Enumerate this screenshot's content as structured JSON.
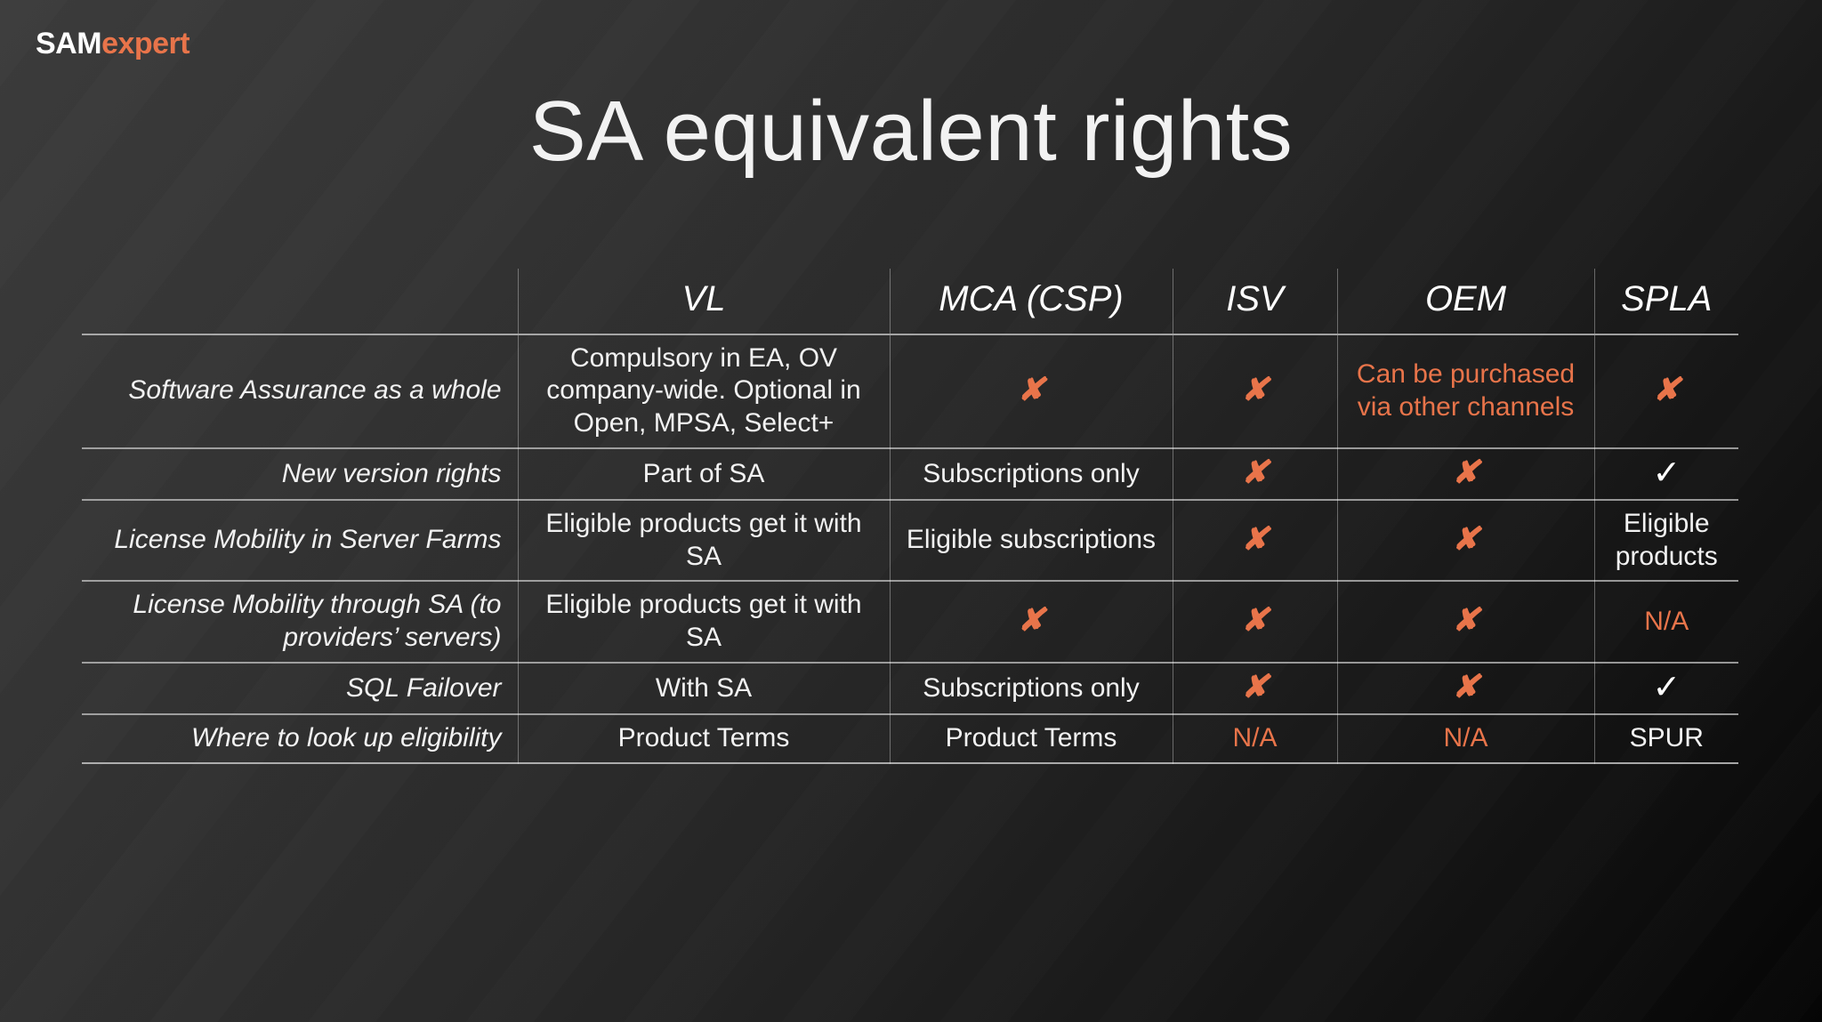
{
  "brand": {
    "logo_primary": "SAM",
    "logo_secondary": "expert",
    "accent_color": "#e8744a",
    "text_color": "#f2f2f2"
  },
  "slide": {
    "title": "SA equivalent rights"
  },
  "table": {
    "corner_label": "",
    "columns": [
      {
        "key": "vl",
        "label": "VL"
      },
      {
        "key": "mca",
        "label": "MCA (CSP)"
      },
      {
        "key": "isv",
        "label": "ISV"
      },
      {
        "key": "oem",
        "label": "OEM"
      },
      {
        "key": "spla",
        "label": "SPLA"
      }
    ],
    "rows": [
      {
        "label": "Software Assurance as a whole",
        "vl": {
          "text": "Compulsory in EA, OV company-wide. Optional in Open, MPSA, Select+",
          "kind": "text",
          "color": "white"
        },
        "mca": {
          "text": "✘",
          "kind": "x",
          "color": "accent"
        },
        "isv": {
          "text": "✘",
          "kind": "x",
          "color": "accent"
        },
        "oem": {
          "text": "Can be purchased via other channels",
          "kind": "text",
          "color": "accent"
        },
        "spla": {
          "text": "✘",
          "kind": "x",
          "color": "accent"
        }
      },
      {
        "label": "New version rights",
        "vl": {
          "text": "Part of SA",
          "kind": "text",
          "color": "white"
        },
        "mca": {
          "text": "Subscriptions only",
          "kind": "text",
          "color": "white"
        },
        "isv": {
          "text": "✘",
          "kind": "x",
          "color": "accent"
        },
        "oem": {
          "text": "✘",
          "kind": "x",
          "color": "accent"
        },
        "spla": {
          "text": "✓",
          "kind": "check",
          "color": "white"
        }
      },
      {
        "label": "License Mobility in Server Farms",
        "vl": {
          "text": "Eligible products get it with SA",
          "kind": "text",
          "color": "white"
        },
        "mca": {
          "text": "Eligible subscriptions",
          "kind": "text",
          "color": "white"
        },
        "isv": {
          "text": "✘",
          "kind": "x",
          "color": "accent"
        },
        "oem": {
          "text": "✘",
          "kind": "x",
          "color": "accent"
        },
        "spla": {
          "text": "Eligible products",
          "kind": "text",
          "color": "white"
        }
      },
      {
        "label": "License Mobility through SA (to providers’ servers)",
        "vl": {
          "text": "Eligible products get it with SA",
          "kind": "text",
          "color": "white"
        },
        "mca": {
          "text": "✘",
          "kind": "x",
          "color": "accent"
        },
        "isv": {
          "text": "✘",
          "kind": "x",
          "color": "accent"
        },
        "oem": {
          "text": "✘",
          "kind": "x",
          "color": "accent"
        },
        "spla": {
          "text": "N/A",
          "kind": "text",
          "color": "accent"
        }
      },
      {
        "label": "SQL Failover",
        "vl": {
          "text": "With SA",
          "kind": "text",
          "color": "white"
        },
        "mca": {
          "text": "Subscriptions only",
          "kind": "text",
          "color": "white"
        },
        "isv": {
          "text": "✘",
          "kind": "x",
          "color": "accent"
        },
        "oem": {
          "text": "✘",
          "kind": "x",
          "color": "accent"
        },
        "spla": {
          "text": "✓",
          "kind": "check",
          "color": "white"
        }
      },
      {
        "label": "Where to look up eligibility",
        "vl": {
          "text": "Product Terms",
          "kind": "text",
          "color": "white"
        },
        "mca": {
          "text": "Product Terms",
          "kind": "text",
          "color": "white"
        },
        "isv": {
          "text": "N/A",
          "kind": "text",
          "color": "accent"
        },
        "oem": {
          "text": "N/A",
          "kind": "text",
          "color": "accent"
        },
        "spla": {
          "text": "SPUR",
          "kind": "text",
          "color": "white"
        }
      }
    ]
  }
}
